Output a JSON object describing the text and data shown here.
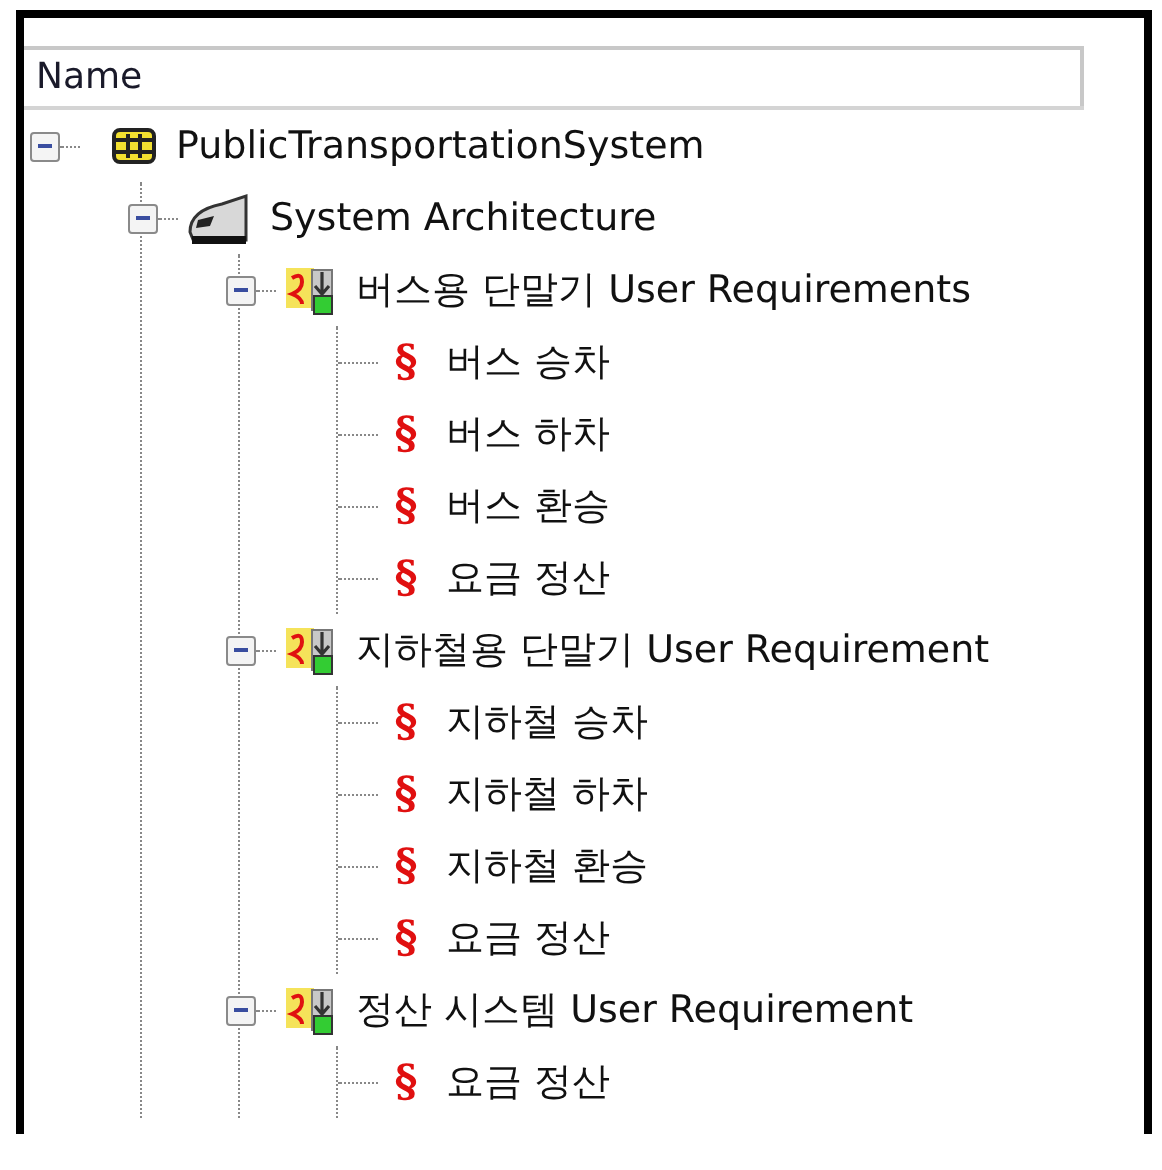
{
  "header": {
    "columns": [
      "Name"
    ]
  },
  "tree": [
    {
      "kind": "system",
      "label": "PublicTransportationSystem",
      "expanded": true,
      "children": [
        {
          "kind": "architecture",
          "label": "System Architecture",
          "expanded": true,
          "children": [
            {
              "kind": "package",
              "label": "버스용 단말기 User Requirements",
              "expanded": true,
              "children": [
                {
                  "kind": "requirement",
                  "marker": "§",
                  "label": "버스 승차"
                },
                {
                  "kind": "requirement",
                  "marker": "§",
                  "label": "버스 하차"
                },
                {
                  "kind": "requirement",
                  "marker": "§",
                  "label": "버스 환승"
                },
                {
                  "kind": "requirement",
                  "marker": "§",
                  "label": "요금 정산"
                }
              ]
            },
            {
              "kind": "package",
              "label": "지하철용 단말기 User Requirement",
              "expanded": true,
              "children": [
                {
                  "kind": "requirement",
                  "marker": "§",
                  "label": "지하철 승차"
                },
                {
                  "kind": "requirement",
                  "marker": "§",
                  "label": "지하철 하차"
                },
                {
                  "kind": "requirement",
                  "marker": "§",
                  "label": "지하철 환승"
                },
                {
                  "kind": "requirement",
                  "marker": "§",
                  "label": "요금 정산"
                }
              ]
            },
            {
              "kind": "package",
              "label": "정산 시스템 User Requirement",
              "expanded": true,
              "children": [
                {
                  "kind": "requirement",
                  "marker": "§",
                  "label": "요금 정산"
                }
              ]
            }
          ]
        }
      ]
    }
  ]
}
